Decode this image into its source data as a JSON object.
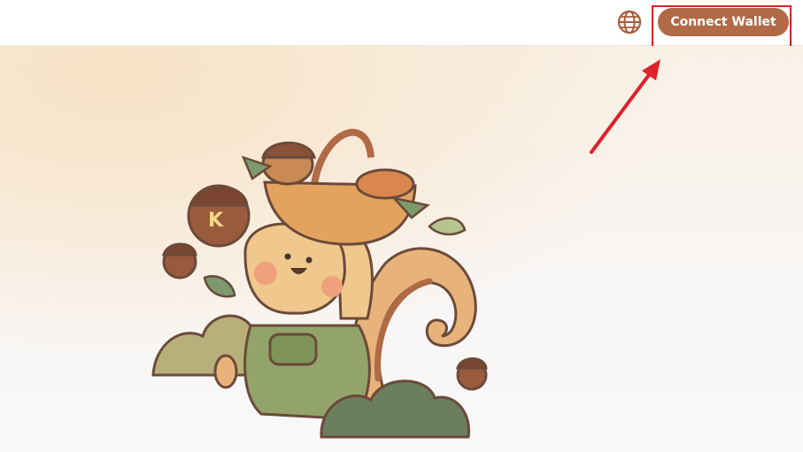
{
  "header": {
    "language_icon": "globe-icon",
    "connect_wallet_label": "Connect Wallet"
  },
  "annotation": {
    "highlight_color": "#e0202a",
    "arrow_color": "#e0202a"
  },
  "colors": {
    "accent": "#b06a45",
    "globe": "#a85a3a"
  },
  "hero": {
    "illustration": "squirrel-with-acorn-basket-illustration"
  }
}
